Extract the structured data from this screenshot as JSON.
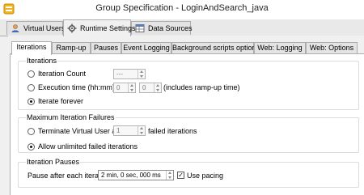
{
  "window": {
    "title": "Group Specification - LoginAndSearch_java"
  },
  "top_tabs": [
    {
      "label": "Virtual Users",
      "icon": "users-icon",
      "active": false
    },
    {
      "label": "Runtime Settings",
      "icon": "gear-icon",
      "active": true
    },
    {
      "label": "Data Sources",
      "icon": "table-icon",
      "active": false
    }
  ],
  "sub_tabs": [
    {
      "label": "Iterations",
      "active": true
    },
    {
      "label": "Ramp-up",
      "active": false
    },
    {
      "label": "Pauses",
      "active": false
    },
    {
      "label": "Event Logging",
      "active": false
    },
    {
      "label": "Background scripts options",
      "active": false
    },
    {
      "label": "Web: Logging",
      "active": false
    },
    {
      "label": "Web: Options",
      "active": false
    }
  ],
  "iterations": {
    "title": "Iterations",
    "iteration_count_label": "Iteration Count",
    "iteration_count_value": "---",
    "execution_time_label": "Execution time (hh:mm)",
    "hours_value": "0",
    "minutes_value": "0",
    "execution_time_note": "(includes ramp-up time)",
    "iterate_forever_label": "Iterate forever",
    "selected": "iterate_forever"
  },
  "max_failures": {
    "title": "Maximum Iteration Failures",
    "terminate_label": "Terminate Virtual User after",
    "failures_value": "1",
    "failed_iterations_label": "failed iterations",
    "allow_unlimited_label": "Allow unlimited failed iterations",
    "selected": "allow_unlimited"
  },
  "iteration_pauses": {
    "title": "Iteration Pauses",
    "pause_label": "Pause after each iteration:",
    "pause_value": "2 min, 0 sec, 000 ms",
    "use_pacing_label": "Use pacing",
    "use_pacing_checked": true
  },
  "colors": {
    "tab_border": "#adadad",
    "panel_bg": "#f0f0f0",
    "content_bg": "#ffffff"
  }
}
